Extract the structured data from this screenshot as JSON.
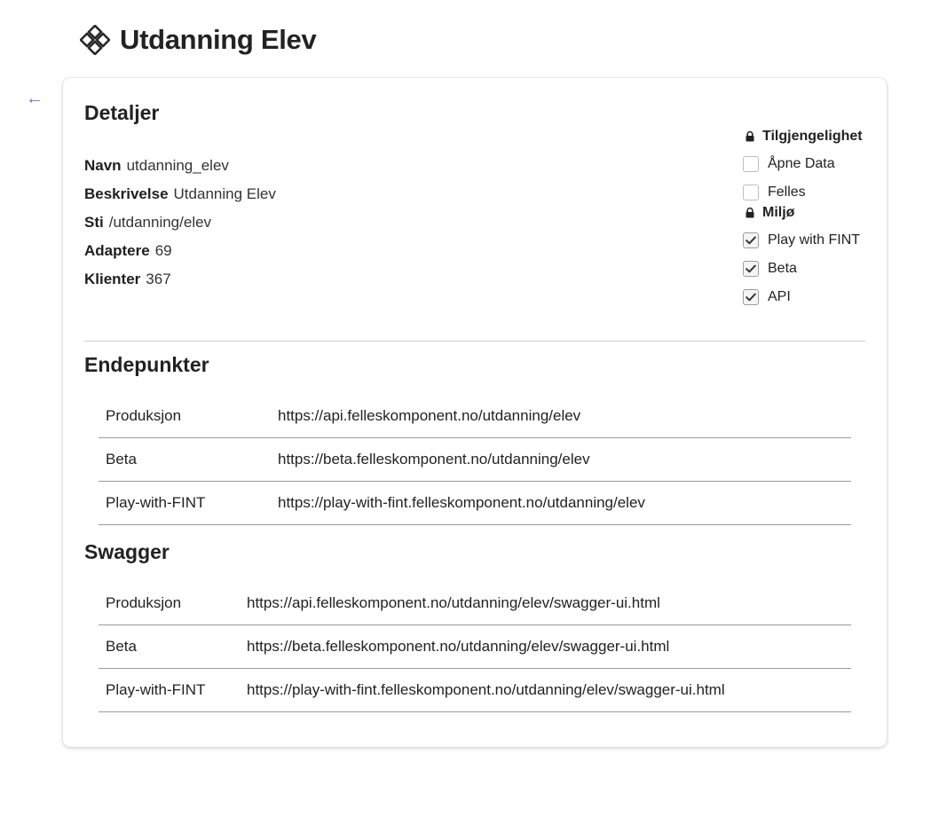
{
  "header": {
    "title": "Utdanning Elev",
    "icon": "component-diamond-icon"
  },
  "back": {
    "icon": "arrow-left-icon",
    "glyph": "←",
    "color": "#7b68c8"
  },
  "details": {
    "title": "Detaljer",
    "rows": [
      {
        "label": "Navn",
        "value": "utdanning_elev"
      },
      {
        "label": "Beskrivelse",
        "value": "Utdanning Elev"
      },
      {
        "label": "Sti",
        "value": "/utdanning/elev"
      },
      {
        "label": "Adaptere",
        "value": "69"
      },
      {
        "label": "Klienter",
        "value": "367"
      }
    ]
  },
  "availability": {
    "heading": "Tilgjengelighet",
    "icon": "lock-icon",
    "options": [
      {
        "label": "Åpne Data",
        "checked": false
      },
      {
        "label": "Felles",
        "checked": false
      }
    ]
  },
  "environment": {
    "heading": "Miljø",
    "icon": "lock-icon",
    "options": [
      {
        "label": "Play with FINT",
        "checked": true
      },
      {
        "label": "Beta",
        "checked": true
      },
      {
        "label": "API",
        "checked": true
      }
    ]
  },
  "endpoints": {
    "title": "Endepunkter",
    "rows": [
      {
        "env": "Produksjon",
        "url": "https://api.felleskomponent.no/utdanning/elev"
      },
      {
        "env": "Beta",
        "url": "https://beta.felleskomponent.no/utdanning/elev"
      },
      {
        "env": "Play-with-FINT",
        "url": "https://play-with-fint.felleskomponent.no/utdanning/elev"
      }
    ]
  },
  "swagger": {
    "title": "Swagger",
    "rows": [
      {
        "env": "Produksjon",
        "url": "https://api.felleskomponent.no/utdanning/elev/swagger-ui.html"
      },
      {
        "env": "Beta",
        "url": "https://beta.felleskomponent.no/utdanning/elev/swagger-ui.html"
      },
      {
        "env": "Play-with-FINT",
        "url": "https://play-with-fint.felleskomponent.no/utdanning/elev/swagger-ui.html"
      }
    ]
  },
  "colors": {
    "accent": "#7b68c8",
    "text": "#222222",
    "divider": "#d0d0d0"
  }
}
